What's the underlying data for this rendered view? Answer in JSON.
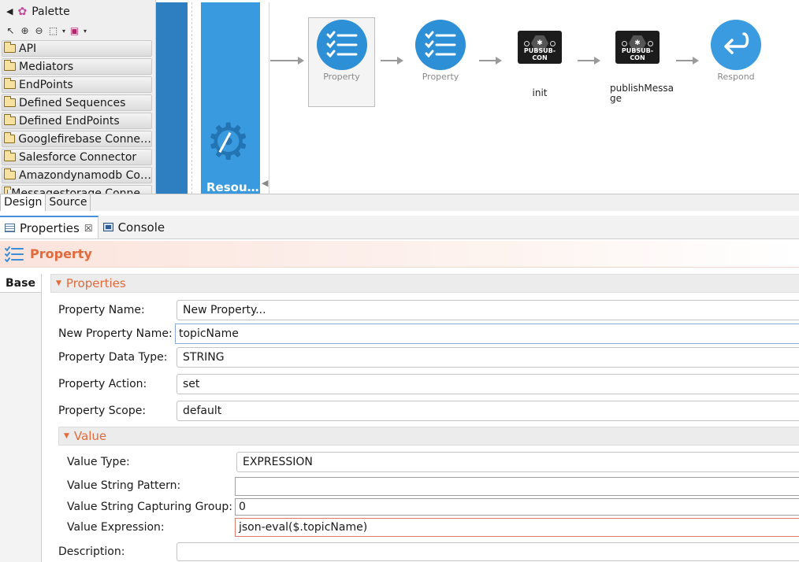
{
  "palette": {
    "title": "Palette",
    "items": [
      "API",
      "Mediators",
      "EndPoints",
      "Defined Sequences",
      "Defined EndPoints",
      "Googlefirebase Conne…",
      "Salesforce Connector",
      "Amazondynamodb Co…",
      "Messagestorage Conne…"
    ]
  },
  "canvas": {
    "resource_label": "Resou…",
    "nodes": {
      "property1": "Property",
      "property2": "Property",
      "pubsub_badge": "PUBSUB-CON",
      "init": "init",
      "publish": "publishMessa\nge",
      "respond": "Respond"
    }
  },
  "editor_tabs": [
    "Design",
    "Source"
  ],
  "view_tabs": {
    "properties": "Properties",
    "console": "Console"
  },
  "panel": {
    "title": "Property",
    "side_tab": "Base",
    "section_properties": "Properties",
    "section_value": "Value",
    "fields": {
      "property_name": {
        "label": "Property Name:",
        "value": "New Property..."
      },
      "new_name": {
        "label": "New Property Name:",
        "value": "topicName"
      },
      "data_type": {
        "label": "Property Data Type:",
        "value": "STRING"
      },
      "action": {
        "label": "Property Action:",
        "value": "set"
      },
      "scope": {
        "label": "Property Scope:",
        "value": "default"
      },
      "value_type": {
        "label": "Value Type:",
        "value": "EXPRESSION"
      },
      "string_pattern": {
        "label": "Value String Pattern:",
        "value": ""
      },
      "capture_group": {
        "label": "Value String Capturing Group:",
        "value": "0"
      },
      "expression": {
        "label": "Value Expression:",
        "value": "json-eval($.topicName)"
      },
      "description": {
        "label": "Description:",
        "value": ""
      }
    }
  },
  "colors": {
    "accent": "#e46a3c",
    "node_blue": "#2d8fd6",
    "resource_blue": "#3a9adf"
  },
  "icons": {
    "palette": "palette-icon",
    "property_node": "checklist-icon",
    "respond_node": "return-arrow-icon",
    "resource": "gear-icon"
  }
}
